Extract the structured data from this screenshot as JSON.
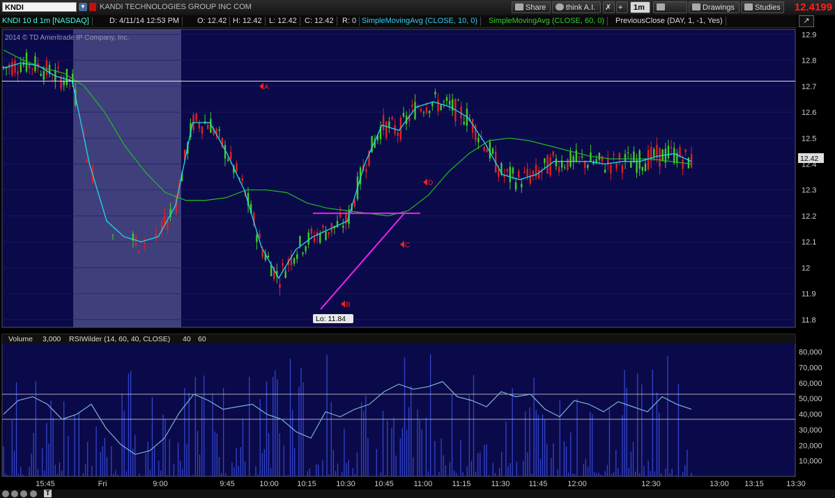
{
  "toolbar": {
    "symbol": "KNDI",
    "company": "KANDI TECHNOLOGIES GROUP INC COM",
    "share": "Share",
    "think_ai": "think A.I.",
    "timeframe": "1m",
    "style": "Style",
    "drawings": "Drawings",
    "studies": "Studies",
    "last_price": "12.4199"
  },
  "infobar": {
    "symbol_desc": "KNDI 10 d 1m [NASDAQ]",
    "date": "D: 4/11/14 12:53 PM",
    "open": "O: 12.42",
    "high": "H: 12.42",
    "low": "L: 12.42",
    "close": "C: 12.42",
    "range": "R: 0",
    "sma10": "SimpleMovingAvg (CLOSE, 10, 0)",
    "sma60": "SimpleMovingAvg (CLOSE, 60, 0)",
    "prevclose": "PreviousClose (DAY, 1, -1, Yes)"
  },
  "copyright": "2014 © TD Ameritrade IP Company, Inc.",
  "lower_panel": {
    "volume_label": "Volume",
    "volume_scale": "3,000",
    "rsi_label": "RSIWilder (14, 60, 40, CLOSE)",
    "level_low": "40",
    "level_high": "60"
  },
  "colors": {
    "bg": "#0a0a4a",
    "up": "#44cc22",
    "down": "#dd2222",
    "sma10": "#22d8ee",
    "sma60": "#22bb22",
    "rsi": "#7fb3d0",
    "volume": "#3344cc",
    "trendline": "#ee22ee",
    "marker": "#ee2222"
  },
  "chart_data": [
    {
      "type": "line",
      "title": "KNDI 10 d 1m [NASDAQ]",
      "ylim": [
        11.77,
        12.92
      ],
      "yticks": [
        11.8,
        11.9,
        12,
        12.1,
        12.2,
        12.3,
        12.4,
        12.5,
        12.6,
        12.7,
        12.8,
        12.9
      ],
      "ytick_labels": [
        "11.8",
        "11.9",
        "12",
        "12.1",
        "12.2",
        "12.3",
        "12.4",
        "12.5",
        "12.6",
        "12.7",
        "12.8",
        "12.9"
      ],
      "xtick_labels": [
        "15:45",
        "Fri",
        "9:00",
        "9:45",
        "10:00",
        "10:15",
        "10:30",
        "10:45",
        "11:00",
        "11:15",
        "11:30",
        "11:45",
        "12:00",
        "12:30",
        "13:00",
        "13:15",
        "13:30"
      ],
      "series": [
        {
          "name": "SimpleMovingAvg (CLOSE, 10, 0)",
          "values": [
            12.77,
            12.79,
            12.78,
            12.74,
            12.72,
            12.4,
            12.18,
            12.12,
            12.1,
            12.12,
            12.24,
            12.56,
            12.56,
            12.44,
            12.3,
            12.08,
            11.96,
            12.07,
            12.12,
            12.15,
            12.18,
            12.4,
            12.55,
            12.53,
            12.62,
            12.64,
            12.62,
            12.58,
            12.48,
            12.36,
            12.34,
            12.36,
            12.41,
            12.41,
            12.41,
            12.4,
            12.41,
            12.41,
            12.43,
            12.44,
            12.41
          ]
        },
        {
          "name": "SimpleMovingAvg (CLOSE, 60, 0)",
          "values": [
            12.84,
            12.8,
            12.77,
            12.75,
            12.7,
            12.6,
            12.47,
            12.37,
            12.29,
            12.26,
            12.26,
            12.27,
            12.3,
            12.3,
            12.29,
            12.25,
            12.23,
            12.22,
            12.21,
            12.2,
            12.22,
            12.28,
            12.37,
            12.44,
            12.49,
            12.5,
            12.49,
            12.47,
            12.45,
            12.43,
            12.42,
            12.42,
            12.42,
            12.41,
            12.4
          ]
        }
      ],
      "price_label": "12.42",
      "previous_close": 12.72,
      "low_label": "Lo: 11.84",
      "low_value": 11.84,
      "markers": [
        {
          "label": "A",
          "y": 12.7
        },
        {
          "label": "B",
          "y": 11.86
        },
        {
          "label": "C",
          "y": 12.09
        },
        {
          "label": "D",
          "y": 12.33
        }
      ],
      "resistance": 12.21
    },
    {
      "type": "line",
      "title": "RSIWilder (14, 60, 40, CLOSE)",
      "ylim": [
        0,
        85000
      ],
      "yticks": [
        10000,
        20000,
        30000,
        40000,
        50000,
        60000,
        70000,
        80000
      ],
      "ytick_labels": [
        "10,000",
        "20,000",
        "30,000",
        "40,000",
        "50,000",
        "60,000",
        "70,000",
        "80,000"
      ],
      "rsi_levels": [
        40,
        60
      ],
      "series": [
        {
          "name": "RSIWilder",
          "values": [
            44,
            55,
            58,
            52,
            40,
            44,
            52,
            33,
            20,
            12,
            15,
            25,
            45,
            60,
            55,
            48,
            50,
            52,
            44,
            40,
            30,
            25,
            46,
            42,
            48,
            52,
            62,
            68,
            64,
            66,
            70,
            58,
            55,
            50,
            62,
            58,
            60,
            48,
            42,
            55,
            52,
            46,
            54,
            50,
            46,
            58,
            52,
            48
          ]
        }
      ]
    }
  ]
}
